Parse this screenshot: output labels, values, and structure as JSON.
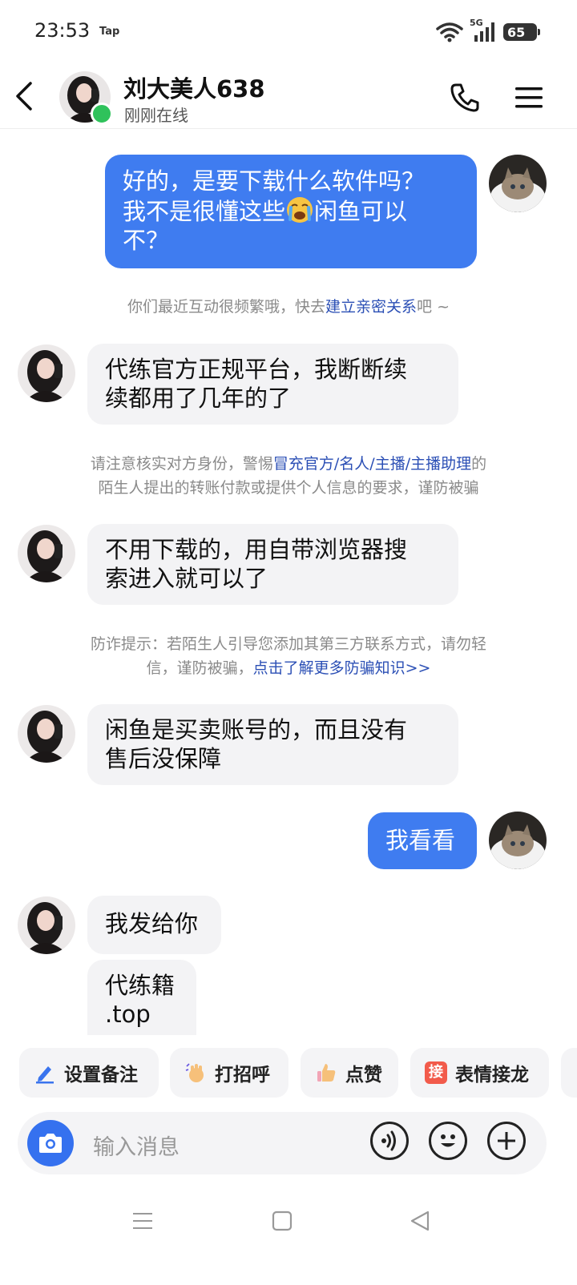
{
  "status_bar": {
    "time": "23:53",
    "tap_label": "Tap",
    "network": "5G",
    "battery": "65"
  },
  "header": {
    "contact_name": "刘大美人638",
    "contact_status": "刚刚在线"
  },
  "messages": [
    {
      "from": "me",
      "lines": [
        "好的，是要下载什么软件吗？",
        "我不是很懂这些",
        "闲鱼可以",
        "不？"
      ],
      "emoji": "loudly-crying-face-icon"
    },
    {
      "from": "contact",
      "lines": [
        "代练官方正规平台，我断断续",
        "续都用了几年的了"
      ]
    },
    {
      "from": "contact",
      "lines": [
        "不用下载的，用自带浏览器搜",
        "索进入就可以了"
      ]
    },
    {
      "from": "contact",
      "lines": [
        "闲鱼是买卖账号的，而且没有",
        "售后没保障"
      ]
    },
    {
      "from": "me",
      "lines": [
        "我看看"
      ]
    },
    {
      "from": "contact",
      "lines": [
        "我发给你"
      ]
    },
    {
      "from": "contact",
      "lines": [
        "代练籍",
        ".top"
      ]
    }
  ],
  "notices": {
    "intimacy": {
      "text": "你们最近互动很频繁哦，快去",
      "link": "建立亲密关系",
      "suffix": "吧 ~"
    },
    "identity": {
      "line1_prefix": "请注意核实对方身份，警惕",
      "link": "冒充官方/名人/主播/主播助理",
      "line1_suffix": "的",
      "line2": "陌生人提出的转账付款或提供个人信息的要求，谨防被骗"
    },
    "fraud": {
      "line1": "防诈提示：若陌生人引导您添加其第三方联系方式，请勿轻",
      "line2_prefix": "信，谨防被骗，",
      "link": "点击了解更多防骗知识>>"
    }
  },
  "quick_actions": [
    {
      "label": "设置备注",
      "icon": "pencil-icon"
    },
    {
      "label": "打招呼",
      "icon": "waving-hand-icon"
    },
    {
      "label": "点赞",
      "icon": "thumbs-up-icon"
    },
    {
      "label": "表情接龙",
      "icon": "jie-badge-icon",
      "badge": "接"
    }
  ],
  "input": {
    "placeholder": "输入消息"
  },
  "colors": {
    "accent": "#3f7cf0",
    "online": "#2fc25b",
    "link": "#2b4fb5"
  }
}
